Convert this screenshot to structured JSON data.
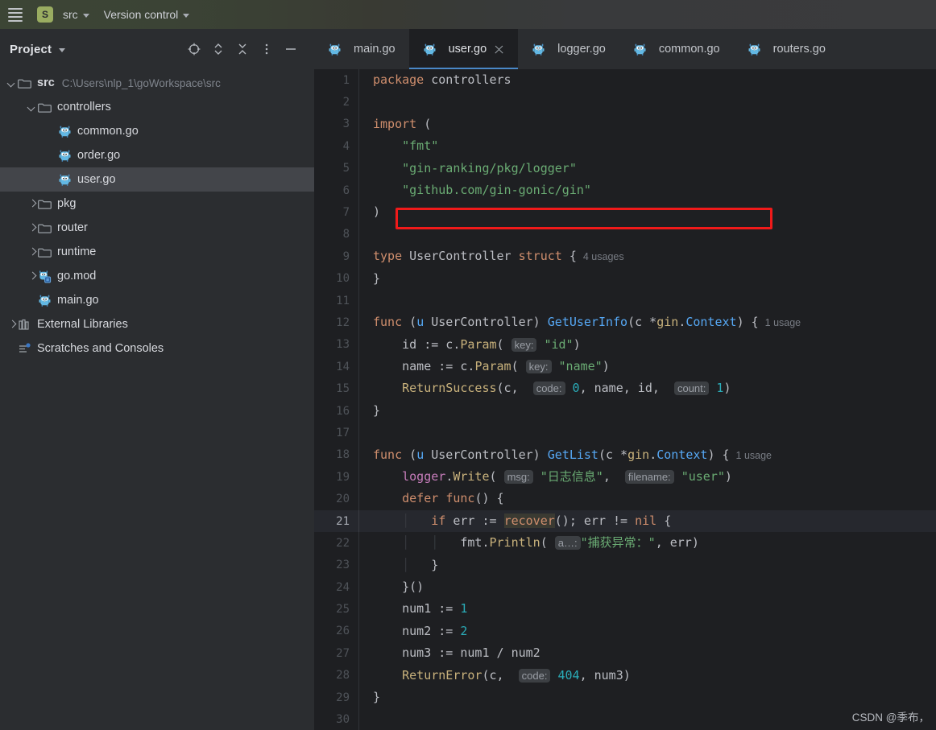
{
  "header": {
    "menu_icon": "hamburger-icon",
    "project_badge": "S",
    "project_name": "src",
    "version_control": "Version control"
  },
  "sidebar": {
    "title": "Project",
    "actions": [
      {
        "name": "select-opened-file-icon",
        "label": "Select Opened File"
      },
      {
        "name": "expand-collapse-icon",
        "label": "Expand / Collapse"
      },
      {
        "name": "collapse-all-icon",
        "label": "Collapse All"
      },
      {
        "name": "more-options-icon",
        "label": "More Options"
      },
      {
        "name": "hide-panel-icon",
        "label": "Hide"
      }
    ],
    "tree": [
      {
        "label": "src",
        "path": "C:\\Users\\nlp_1\\goWorkspace\\src",
        "icon": "folder-icon",
        "arrow": "down",
        "indent": 0,
        "bold": true,
        "selected": false
      },
      {
        "label": "controllers",
        "path": "",
        "icon": "folder-icon",
        "arrow": "down",
        "indent": 1,
        "bold": false,
        "selected": false
      },
      {
        "label": "common.go",
        "path": "",
        "icon": "go-file-icon",
        "arrow": "none",
        "indent": 2,
        "bold": false,
        "selected": false
      },
      {
        "label": "order.go",
        "path": "",
        "icon": "go-file-icon",
        "arrow": "none",
        "indent": 2,
        "bold": false,
        "selected": false
      },
      {
        "label": "user.go",
        "path": "",
        "icon": "go-file-icon",
        "arrow": "none",
        "indent": 2,
        "bold": false,
        "selected": true
      },
      {
        "label": "pkg",
        "path": "",
        "icon": "folder-icon",
        "arrow": "right",
        "indent": 1,
        "bold": false,
        "selected": false
      },
      {
        "label": "router",
        "path": "",
        "icon": "folder-icon",
        "arrow": "right",
        "indent": 1,
        "bold": false,
        "selected": false
      },
      {
        "label": "runtime",
        "path": "",
        "icon": "folder-icon",
        "arrow": "right",
        "indent": 1,
        "bold": false,
        "selected": false
      },
      {
        "label": "go.mod",
        "path": "",
        "icon": "go-mod-icon",
        "arrow": "right",
        "indent": 1,
        "bold": false,
        "selected": false
      },
      {
        "label": "main.go",
        "path": "",
        "icon": "go-file-icon",
        "arrow": "none",
        "indent": 1,
        "bold": false,
        "selected": false
      },
      {
        "label": "External Libraries",
        "path": "",
        "icon": "library-icon",
        "arrow": "right",
        "indent": 0,
        "bold": false,
        "selected": false
      },
      {
        "label": "Scratches and Consoles",
        "path": "",
        "icon": "scratches-icon",
        "arrow": "none",
        "indent": 0,
        "bold": false,
        "selected": false
      }
    ]
  },
  "editor": {
    "tabs": [
      {
        "label": "main.go",
        "icon": "go-file-icon",
        "active": false,
        "closable": false
      },
      {
        "label": "user.go",
        "icon": "go-file-icon",
        "active": true,
        "closable": true
      },
      {
        "label": "logger.go",
        "icon": "go-file-icon",
        "active": false,
        "closable": false
      },
      {
        "label": "common.go",
        "icon": "go-file-icon",
        "active": false,
        "closable": false
      },
      {
        "label": "routers.go",
        "icon": "go-file-icon",
        "active": false,
        "closable": false
      }
    ],
    "caret_line": 21,
    "annotation": {
      "shape": "rectangle",
      "color": "#f01a1a",
      "target_line": 19
    },
    "lines": [
      {
        "n": 1,
        "tokens": [
          {
            "t": "package ",
            "c": "kw"
          },
          {
            "t": "controllers",
            "c": "plain"
          }
        ]
      },
      {
        "n": 2,
        "tokens": []
      },
      {
        "n": 3,
        "tokens": [
          {
            "t": "import ",
            "c": "kw"
          },
          {
            "t": "(",
            "c": "plain"
          }
        ]
      },
      {
        "n": 4,
        "tokens": [
          {
            "t": "    ",
            "c": "plain"
          },
          {
            "t": "\"fmt\"",
            "c": "str"
          }
        ]
      },
      {
        "n": 5,
        "tokens": [
          {
            "t": "    ",
            "c": "plain"
          },
          {
            "t": "\"gin-ranking/pkg/logger\"",
            "c": "str"
          }
        ]
      },
      {
        "n": 6,
        "tokens": [
          {
            "t": "    ",
            "c": "plain"
          },
          {
            "t": "\"github.com/gin-gonic/gin\"",
            "c": "str"
          }
        ]
      },
      {
        "n": 7,
        "tokens": [
          {
            "t": ")",
            "c": "plain"
          }
        ]
      },
      {
        "n": 8,
        "tokens": []
      },
      {
        "n": 9,
        "tokens": [
          {
            "t": "type ",
            "c": "kw"
          },
          {
            "t": "UserController ",
            "c": "plain"
          },
          {
            "t": "struct",
            "c": "kw"
          },
          {
            "t": " {",
            "c": "plain"
          },
          {
            "t": "4 usages",
            "c": "usage"
          }
        ]
      },
      {
        "n": 10,
        "tokens": [
          {
            "t": "}",
            "c": "plain"
          }
        ]
      },
      {
        "n": 11,
        "tokens": []
      },
      {
        "n": 12,
        "tokens": [
          {
            "t": "func ",
            "c": "kw"
          },
          {
            "t": "(",
            "c": "plain"
          },
          {
            "t": "u",
            "c": "call"
          },
          {
            "t": " UserController) ",
            "c": "plain"
          },
          {
            "t": "GetUserInfo",
            "c": "call"
          },
          {
            "t": "(c *",
            "c": "plain"
          },
          {
            "t": "gin",
            "c": "fn"
          },
          {
            "t": ".",
            "c": "plain"
          },
          {
            "t": "Context",
            "c": "call"
          },
          {
            "t": ") {",
            "c": "plain"
          },
          {
            "t": "1 usage",
            "c": "usage"
          }
        ]
      },
      {
        "n": 13,
        "tokens": [
          {
            "t": "    id := c.",
            "c": "plain"
          },
          {
            "t": "Param",
            "c": "fn"
          },
          {
            "t": "( ",
            "c": "plain"
          },
          {
            "t": "key:",
            "c": "hint"
          },
          {
            "t": " ",
            "c": "plain"
          },
          {
            "t": "\"id\"",
            "c": "str"
          },
          {
            "t": ")",
            "c": "plain"
          }
        ]
      },
      {
        "n": 14,
        "tokens": [
          {
            "t": "    name := c.",
            "c": "plain"
          },
          {
            "t": "Param",
            "c": "fn"
          },
          {
            "t": "( ",
            "c": "plain"
          },
          {
            "t": "key:",
            "c": "hint"
          },
          {
            "t": " ",
            "c": "plain"
          },
          {
            "t": "\"name\"",
            "c": "str"
          },
          {
            "t": ")",
            "c": "plain"
          }
        ]
      },
      {
        "n": 15,
        "tokens": [
          {
            "t": "    ",
            "c": "plain"
          },
          {
            "t": "ReturnSuccess",
            "c": "fn"
          },
          {
            "t": "(c,  ",
            "c": "plain"
          },
          {
            "t": "code:",
            "c": "hint"
          },
          {
            "t": " ",
            "c": "plain"
          },
          {
            "t": "0",
            "c": "num"
          },
          {
            "t": ", name, id,  ",
            "c": "plain"
          },
          {
            "t": "count:",
            "c": "hint"
          },
          {
            "t": " ",
            "c": "plain"
          },
          {
            "t": "1",
            "c": "num"
          },
          {
            "t": ")",
            "c": "plain"
          }
        ]
      },
      {
        "n": 16,
        "tokens": [
          {
            "t": "}",
            "c": "plain"
          }
        ]
      },
      {
        "n": 17,
        "tokens": []
      },
      {
        "n": 18,
        "tokens": [
          {
            "t": "func ",
            "c": "kw"
          },
          {
            "t": "(",
            "c": "plain"
          },
          {
            "t": "u",
            "c": "call"
          },
          {
            "t": " UserController) ",
            "c": "plain"
          },
          {
            "t": "GetList",
            "c": "call"
          },
          {
            "t": "(c *",
            "c": "plain"
          },
          {
            "t": "gin",
            "c": "fn"
          },
          {
            "t": ".",
            "c": "plain"
          },
          {
            "t": "Context",
            "c": "call"
          },
          {
            "t": ") {",
            "c": "plain"
          },
          {
            "t": "1 usage",
            "c": "usage"
          }
        ]
      },
      {
        "n": 19,
        "tokens": [
          {
            "t": "    ",
            "c": "plain"
          },
          {
            "t": "logger",
            "c": "pkgr"
          },
          {
            "t": ".",
            "c": "plain"
          },
          {
            "t": "Write",
            "c": "fn"
          },
          {
            "t": "( ",
            "c": "plain"
          },
          {
            "t": "msg:",
            "c": "hint"
          },
          {
            "t": " ",
            "c": "plain"
          },
          {
            "t": "\"日志信息\"",
            "c": "str"
          },
          {
            "t": ",  ",
            "c": "plain"
          },
          {
            "t": "filename:",
            "c": "hint"
          },
          {
            "t": " ",
            "c": "plain"
          },
          {
            "t": "\"user\"",
            "c": "str"
          },
          {
            "t": ")",
            "c": "plain"
          }
        ]
      },
      {
        "n": 20,
        "tokens": [
          {
            "t": "    ",
            "c": "plain"
          },
          {
            "t": "defer ",
            "c": "kw"
          },
          {
            "t": "func",
            "c": "kw"
          },
          {
            "t": "() {",
            "c": "plain"
          }
        ]
      },
      {
        "n": 21,
        "tokens": [
          {
            "t": "    ",
            "c": "plain"
          },
          {
            "t": "│",
            "c": "indentline"
          },
          {
            "t": "   ",
            "c": "plain"
          },
          {
            "t": "if ",
            "c": "kw"
          },
          {
            "t": "err := ",
            "c": "plain"
          },
          {
            "t": "recover",
            "c": "recov"
          },
          {
            "t": "(); err != ",
            "c": "plain"
          },
          {
            "t": "nil",
            "c": "kw"
          },
          {
            "t": " {",
            "c": "plain"
          }
        ]
      },
      {
        "n": 22,
        "tokens": [
          {
            "t": "    ",
            "c": "plain"
          },
          {
            "t": "│",
            "c": "indentline"
          },
          {
            "t": "   ",
            "c": "plain"
          },
          {
            "t": "│",
            "c": "indentline"
          },
          {
            "t": "   fmt.",
            "c": "plain"
          },
          {
            "t": "Println",
            "c": "fn"
          },
          {
            "t": "( ",
            "c": "plain"
          },
          {
            "t": "a…:",
            "c": "hint"
          },
          {
            "t": "",
            "c": "plain"
          },
          {
            "t": "\"捕获异常：\"",
            "c": "str"
          },
          {
            "t": ", err)",
            "c": "plain"
          }
        ]
      },
      {
        "n": 23,
        "tokens": [
          {
            "t": "    ",
            "c": "plain"
          },
          {
            "t": "│",
            "c": "indentline"
          },
          {
            "t": "   ",
            "c": "plain"
          },
          {
            "t": "}",
            "c": "plain"
          }
        ]
      },
      {
        "n": 24,
        "tokens": [
          {
            "t": "    }()",
            "c": "plain"
          }
        ]
      },
      {
        "n": 25,
        "tokens": [
          {
            "t": "    num1 := ",
            "c": "plain"
          },
          {
            "t": "1",
            "c": "num"
          }
        ]
      },
      {
        "n": 26,
        "tokens": [
          {
            "t": "    num2 := ",
            "c": "plain"
          },
          {
            "t": "2",
            "c": "num"
          }
        ]
      },
      {
        "n": 27,
        "tokens": [
          {
            "t": "    num3 := num1 / num2",
            "c": "plain"
          }
        ]
      },
      {
        "n": 28,
        "tokens": [
          {
            "t": "    ",
            "c": "plain"
          },
          {
            "t": "ReturnError",
            "c": "fn"
          },
          {
            "t": "(c,  ",
            "c": "plain"
          },
          {
            "t": "code:",
            "c": "hint"
          },
          {
            "t": " ",
            "c": "plain"
          },
          {
            "t": "404",
            "c": "num"
          },
          {
            "t": ", num3)",
            "c": "plain"
          }
        ]
      },
      {
        "n": 29,
        "tokens": [
          {
            "t": "}",
            "c": "plain"
          }
        ]
      },
      {
        "n": 30,
        "tokens": []
      }
    ]
  },
  "watermark": "CSDN @季布，",
  "colors": {
    "accent_tab_underline": "#4a88c7",
    "annotation_red": "#f01a1a",
    "badge_green": "#9aad61",
    "editor_bg": "#1e1f22",
    "sidebar_bg": "#2b2d30",
    "string_green": "#6aab73",
    "keyword_orange": "#cf8e6d",
    "number_cyan": "#2aacb8",
    "function_yellow": "#c9b27c"
  }
}
